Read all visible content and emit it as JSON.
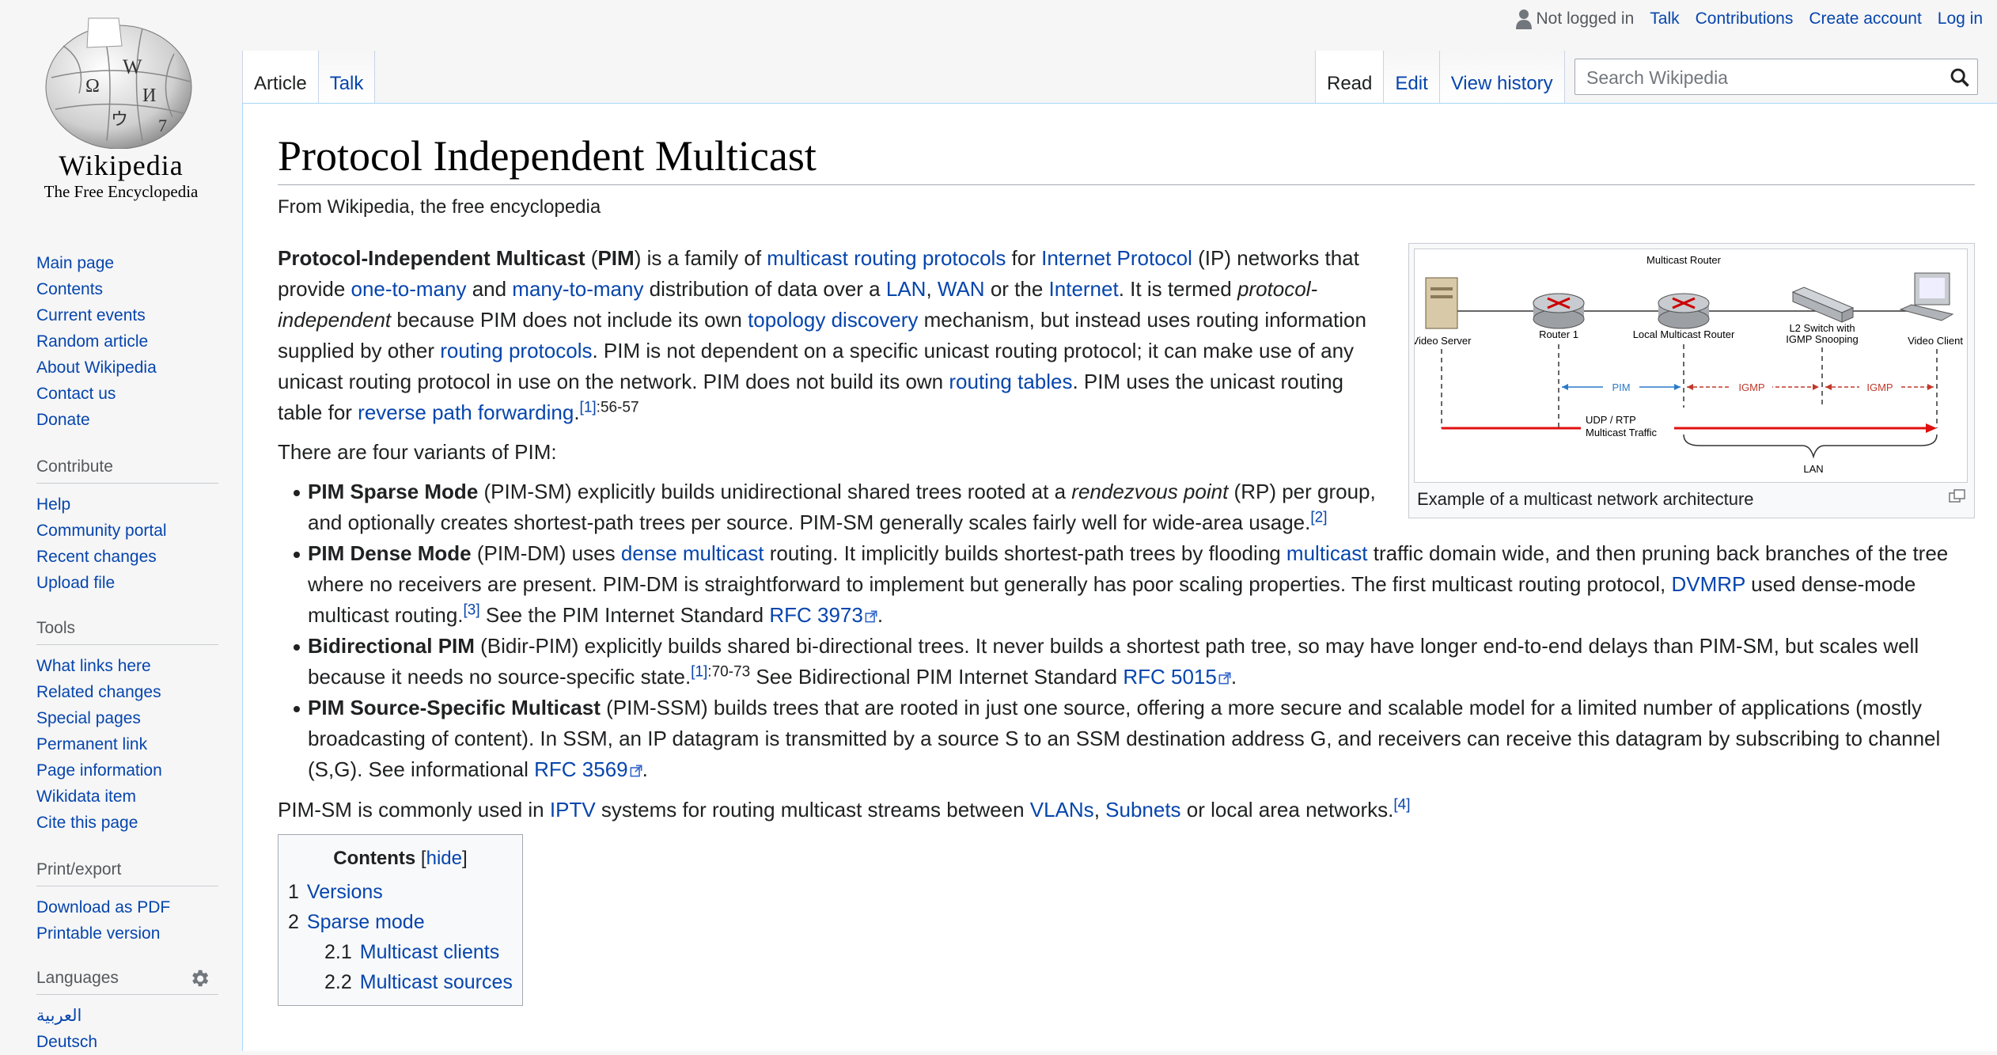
{
  "sidebar": {
    "logo_wordmark": "Wikipedia",
    "logo_tagline": "The Free Encyclopedia",
    "nav": [
      "Main page",
      "Contents",
      "Current events",
      "Random article",
      "About Wikipedia",
      "Contact us",
      "Donate"
    ],
    "contribute_heading": "Contribute",
    "contribute": [
      "Help",
      "Community portal",
      "Recent changes",
      "Upload file"
    ],
    "tools_heading": "Tools",
    "tools": [
      "What links here",
      "Related changes",
      "Special pages",
      "Permanent link",
      "Page information",
      "Wikidata item",
      "Cite this page"
    ],
    "print_heading": "Print/export",
    "print": [
      "Download as PDF",
      "Printable version"
    ],
    "languages_heading": "Languages",
    "languages": [
      "العربية",
      "Deutsch"
    ]
  },
  "personal": {
    "not_logged_in": "Not logged in",
    "talk": "Talk",
    "contributions": "Contributions",
    "create_account": "Create account",
    "log_in": "Log in"
  },
  "tabs": {
    "article": "Article",
    "talk": "Talk",
    "read": "Read",
    "edit": "Edit",
    "view_history": "View history"
  },
  "search": {
    "placeholder": "Search Wikipedia"
  },
  "article": {
    "title": "Protocol Independent Multicast",
    "site_sub": "From Wikipedia, the free encyclopedia",
    "thumb_caption": "Example of a multicast network architecture",
    "diagram": {
      "multicast_router": "Multicast Router",
      "video_server": "Video Server",
      "router1": "Router 1",
      "local_router": "Local Multicast Router",
      "l2_switch_1": "L2 Switch with",
      "l2_switch_2": "IGMP Snooping",
      "video_client": "Video Client",
      "pim": "PIM",
      "igmp": "IGMP",
      "udp_1": "UDP / RTP",
      "udp_2": "Multicast Traffic",
      "lan": "LAN"
    },
    "p1": {
      "b1": "Protocol-Independent Multicast",
      "t1": " (",
      "b2": "PIM",
      "t2": ") is a family of ",
      "l1": "multicast routing protocols",
      "t3": " for ",
      "l2": "Internet Protocol",
      "t4": " (IP) networks that provide ",
      "l3": "one-to-many",
      "t5": " and ",
      "l4": "many-to-many",
      "t6": " distribution of data over a ",
      "l5": "LAN",
      "t7": ", ",
      "l6": "WAN",
      "t8": " or the ",
      "l7": "Internet",
      "t9": ". It is termed ",
      "i1": "protocol-independent",
      "t10": " because PIM does not include its own ",
      "l8": "topology discovery",
      "t11": " mechanism, but instead uses routing information supplied by other ",
      "l9": "routing protocols",
      "t12": ". PIM is not dependent on a specific unicast routing protocol; it can make use of any unicast routing protocol in use on the network. PIM does not build its own ",
      "l10": "routing tables",
      "t13": ". PIM uses the unicast routing table for ",
      "l11": "reverse path forwarding",
      "t14": ".",
      "ref": "[1]",
      "pages": ":56-57"
    },
    "p2": "There are four variants of PIM:",
    "li1": {
      "b": "PIM Sparse Mode",
      "t1": " (PIM-SM) explicitly builds unidirectional shared trees rooted at a ",
      "i": "rendezvous point",
      "t2": " (RP) per group, and optionally creates shortest-path trees per source. PIM-SM generally scales fairly well for wide-area usage.",
      "ref": "[2]"
    },
    "li2": {
      "b": "PIM Dense Mode",
      "t1": " (PIM-DM) uses ",
      "l1": "dense multicast",
      "t2": " routing. It implicitly builds shortest-path trees by flooding ",
      "l2": "multicast",
      "t3": " traffic domain wide, and then pruning back branches of the tree where no receivers are present. PIM-DM is straightforward to implement but generally has poor scaling properties. The first multicast routing protocol, ",
      "l3": "DVMRP",
      "t4": " used dense-mode multicast routing.",
      "ref": "[3]",
      "t5": " See the PIM Internet Standard ",
      "l4": "RFC 3973",
      "t6": "."
    },
    "li3": {
      "b": "Bidirectional PIM",
      "t1": " (Bidir-PIM) explicitly builds shared bi-directional trees. It never builds a shortest path tree, so may have longer end-to-end delays than PIM-SM, but scales well because it needs no source-specific state.",
      "ref": "[1]",
      "pages": ":70-73",
      "t2": " See Bidirectional PIM Internet Standard ",
      "l1": "RFC 5015",
      "t3": "."
    },
    "li4": {
      "b": "PIM Source-Specific Multicast",
      "t1": " (PIM-SSM) builds trees that are rooted in just one source, offering a more secure and scalable model for a limited number of applications (mostly broadcasting of content). In SSM, an IP datagram is transmitted by a source S to an SSM destination address G, and receivers can receive this datagram by subscribing to channel (S,G). See informational ",
      "l1": "RFC 3569",
      "t2": "."
    },
    "p3": {
      "t1": "PIM-SM is commonly used in ",
      "l1": "IPTV",
      "t2": " systems for routing multicast streams between ",
      "l2": "VLANs",
      "t3": ", ",
      "l3": "Subnets",
      "t4": " or local area networks.",
      "ref": "[4]"
    },
    "toc": {
      "title": "Contents",
      "hide_open": "[",
      "hide": "hide",
      "hide_close": "]",
      "items": [
        {
          "num": "1",
          "label": "Versions"
        },
        {
          "num": "2",
          "label": "Sparse mode"
        },
        {
          "num": "2.1",
          "label": "Multicast clients"
        },
        {
          "num": "2.2",
          "label": "Multicast sources"
        }
      ]
    }
  }
}
